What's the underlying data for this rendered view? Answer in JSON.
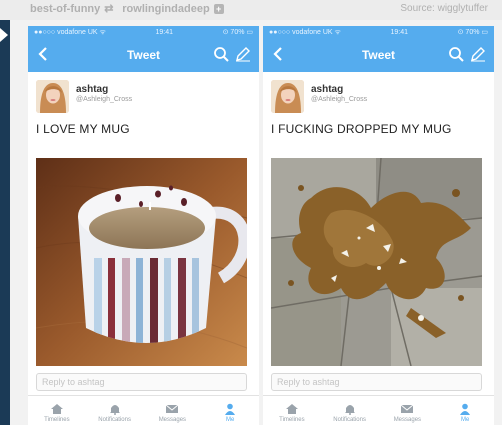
{
  "header": {
    "reblog_from": "best-of-funny",
    "reblog_by": "rowlingindadeep",
    "source": "Source: wigglytuffer"
  },
  "colors": {
    "twitter_blue": "#55acee",
    "sidebar_navy": "#1b3a56"
  },
  "phones": [
    {
      "status": {
        "carrier": "●●○○○ vodafone UK ᯤ",
        "time": "19:41",
        "battery": "⊙ 70% ▭"
      },
      "nav_title": "Tweet",
      "user": {
        "handle": "ashtag",
        "username": "@Ashleigh_Cross"
      },
      "tweet_text": "I LOVE MY MUG",
      "reply_placeholder": "Reply to ashtag",
      "tabs": [
        {
          "label": "Timelines",
          "icon": "home-icon"
        },
        {
          "label": "Notifications",
          "icon": "bell-icon"
        },
        {
          "label": "Messages",
          "icon": "envelope-icon"
        },
        {
          "label": "Me",
          "icon": "person-icon"
        }
      ]
    },
    {
      "status": {
        "carrier": "●●○○○ vodafone UK ᯤ",
        "time": "19:41",
        "battery": "⊙ 70% ▭"
      },
      "nav_title": "Tweet",
      "user": {
        "handle": "ashtag",
        "username": "@Ashleigh_Cross"
      },
      "tweet_text": "I FUCKING DROPPED MY MUG",
      "reply_placeholder": "Reply to ashtag",
      "tabs": [
        {
          "label": "Timelines",
          "icon": "home-icon"
        },
        {
          "label": "Notifications",
          "icon": "bell-icon"
        },
        {
          "label": "Messages",
          "icon": "envelope-icon"
        },
        {
          "label": "Me",
          "icon": "person-icon"
        }
      ]
    }
  ]
}
